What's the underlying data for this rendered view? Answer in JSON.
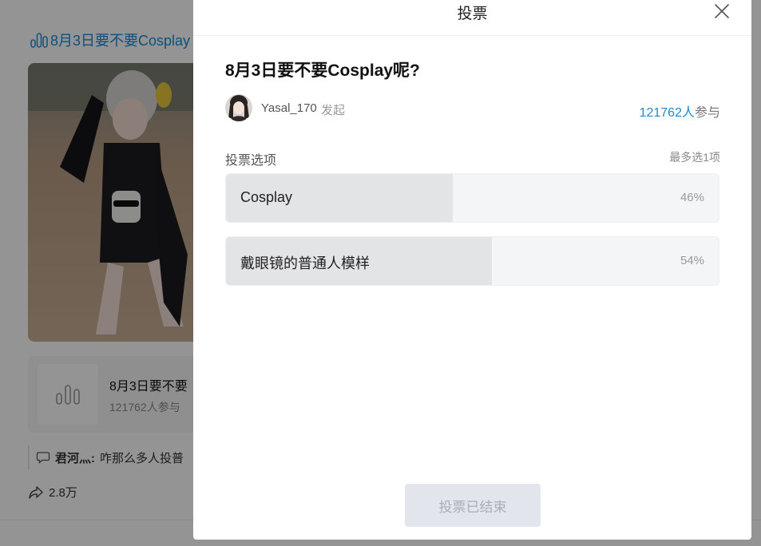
{
  "background": {
    "post_title": "8月3日要不要Cosplay",
    "poll_card": {
      "title": "8月3日要不要",
      "count": "121762人参与"
    },
    "comment": {
      "author": "君河灬:",
      "text": "咋那么多人投普"
    },
    "share_count": "2.8万"
  },
  "modal": {
    "title": "投票",
    "question": "8月3日要不要Cosplay呢?",
    "author": {
      "name": "Yasal_170",
      "suffix": "发起"
    },
    "participants": {
      "number": "121762人",
      "label": "参与"
    },
    "options_label": "投票选项",
    "options_limit": "最多选1项",
    "options": [
      {
        "label": "Cosplay",
        "percent_text": "46%",
        "percent": 46
      },
      {
        "label": "戴眼镜的普通人模样",
        "percent_text": "54%",
        "percent": 54
      }
    ],
    "end_button": "投票已结束"
  },
  "colors": {
    "accent": "#1a8bd6",
    "fill": "#e3e4e6",
    "track": "#f4f5f7",
    "disabled_button": "#e2e5ec"
  },
  "icons": [
    "poll-icon",
    "close-icon",
    "comment-icon",
    "share-icon"
  ]
}
